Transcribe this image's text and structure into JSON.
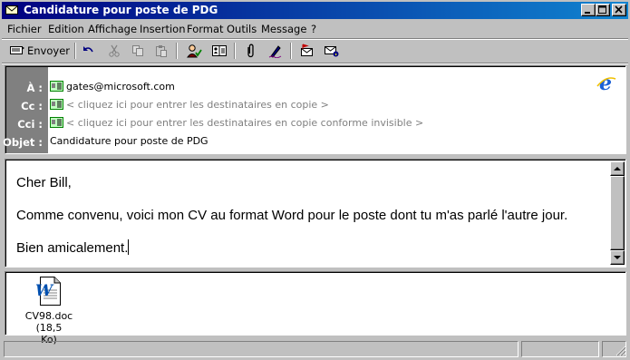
{
  "window": {
    "title": "Candidature pour poste de PDG",
    "controls": [
      "minimize-icon",
      "maximize-icon",
      "close-icon"
    ]
  },
  "menu": {
    "items": [
      {
        "label": "Fichier"
      },
      {
        "label": "Edition"
      },
      {
        "label": "Affichage"
      },
      {
        "label": "Insertion"
      },
      {
        "label": "Format"
      },
      {
        "label": "Outils"
      },
      {
        "label": "Message"
      },
      {
        "label": "?"
      }
    ]
  },
  "toolbar": {
    "send_label": "Envoyer",
    "icons": [
      "send-icon",
      "undo-icon",
      "cut-icon",
      "copy-icon",
      "paste-icon",
      "check-names-icon",
      "address-book-icon",
      "attach-icon",
      "sign-icon",
      "flag-icon",
      "encrypt-icon"
    ]
  },
  "header": {
    "to_label": "À :",
    "to_value": "gates@microsoft.com",
    "cc_label": "Cc :",
    "cc_placeholder": "< cliquez ici pour entrer les destinataires en copie >",
    "bcc_label": "Cci :",
    "bcc_placeholder": "< cliquez ici pour entrer les destinataires en copie conforme invisible >",
    "subject_label": "Objet :",
    "subject_value": "Candidature pour poste de PDG",
    "logo_icon": "ie-logo-icon"
  },
  "body": {
    "line1": "Cher Bill,",
    "line2": "Comme convenu, voici mon CV au format Word pour le poste dont tu m'as parlé l'autre jour.",
    "line3": "Bien amicalement."
  },
  "attachment": {
    "name_line1": "CV98.doc (18,5",
    "name_line2": "Ko)",
    "icon": "word-document-icon"
  },
  "colors": {
    "title_start": "#000080",
    "title_end": "#1084d0",
    "face": "#c0c0c0",
    "label_bg": "#808080"
  }
}
